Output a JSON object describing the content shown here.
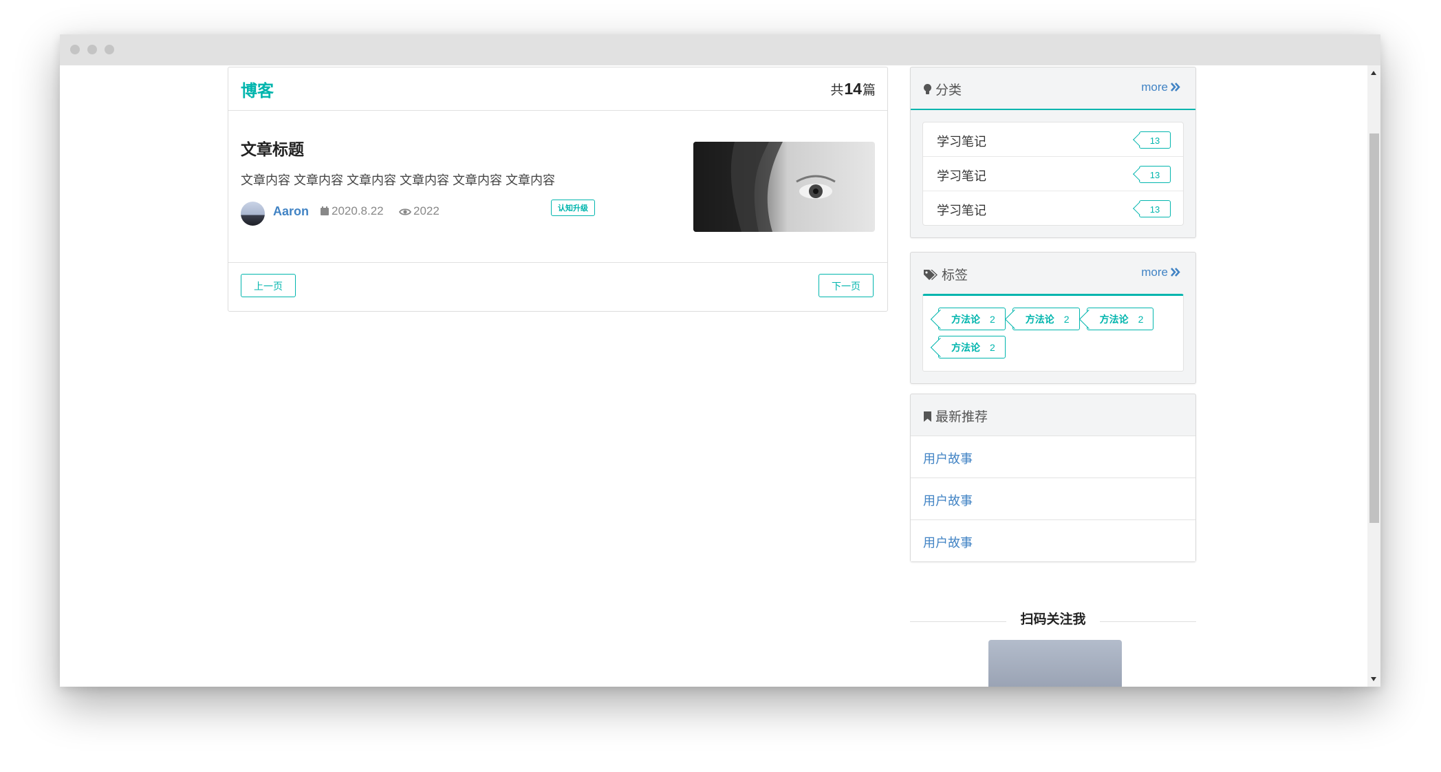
{
  "window": {
    "controls": [
      "close",
      "minimize",
      "maximize"
    ]
  },
  "colors": {
    "accent": "#00b5ad",
    "link": "#4183c4"
  },
  "blog": {
    "title": "博客",
    "count_prefix": "共",
    "count": "14",
    "count_suffix": "篇",
    "article": {
      "title": "文章标题",
      "content": "文章内容 文章内容 文章内容 文章内容 文章内容 文章内容",
      "author": "Aaron",
      "date": "2020.8.22",
      "views": "2022",
      "tag": "认知升级"
    },
    "prev_label": "上一页",
    "next_label": "下一页"
  },
  "sidebar": {
    "categories": {
      "title": "分类",
      "more": "more",
      "items": [
        {
          "label": "学习笔记",
          "count": "13"
        },
        {
          "label": "学习笔记",
          "count": "13"
        },
        {
          "label": "学习笔记",
          "count": "13"
        }
      ]
    },
    "tags": {
      "title": "标签",
      "more": "more",
      "items": [
        {
          "label": "方法论",
          "count": "2"
        },
        {
          "label": "方法论",
          "count": "2"
        },
        {
          "label": "方法论",
          "count": "2"
        },
        {
          "label": "方法论",
          "count": "2"
        }
      ]
    },
    "recommend": {
      "title": "最新推荐",
      "items": [
        "用户故事",
        "用户故事",
        "用户故事"
      ]
    },
    "qr": {
      "title": "扫码关注我"
    }
  },
  "icons": [
    "lightbulb-icon",
    "tags-icon",
    "bookmark-icon",
    "calendar-icon",
    "eye-icon",
    "double-chevron-right-icon"
  ]
}
